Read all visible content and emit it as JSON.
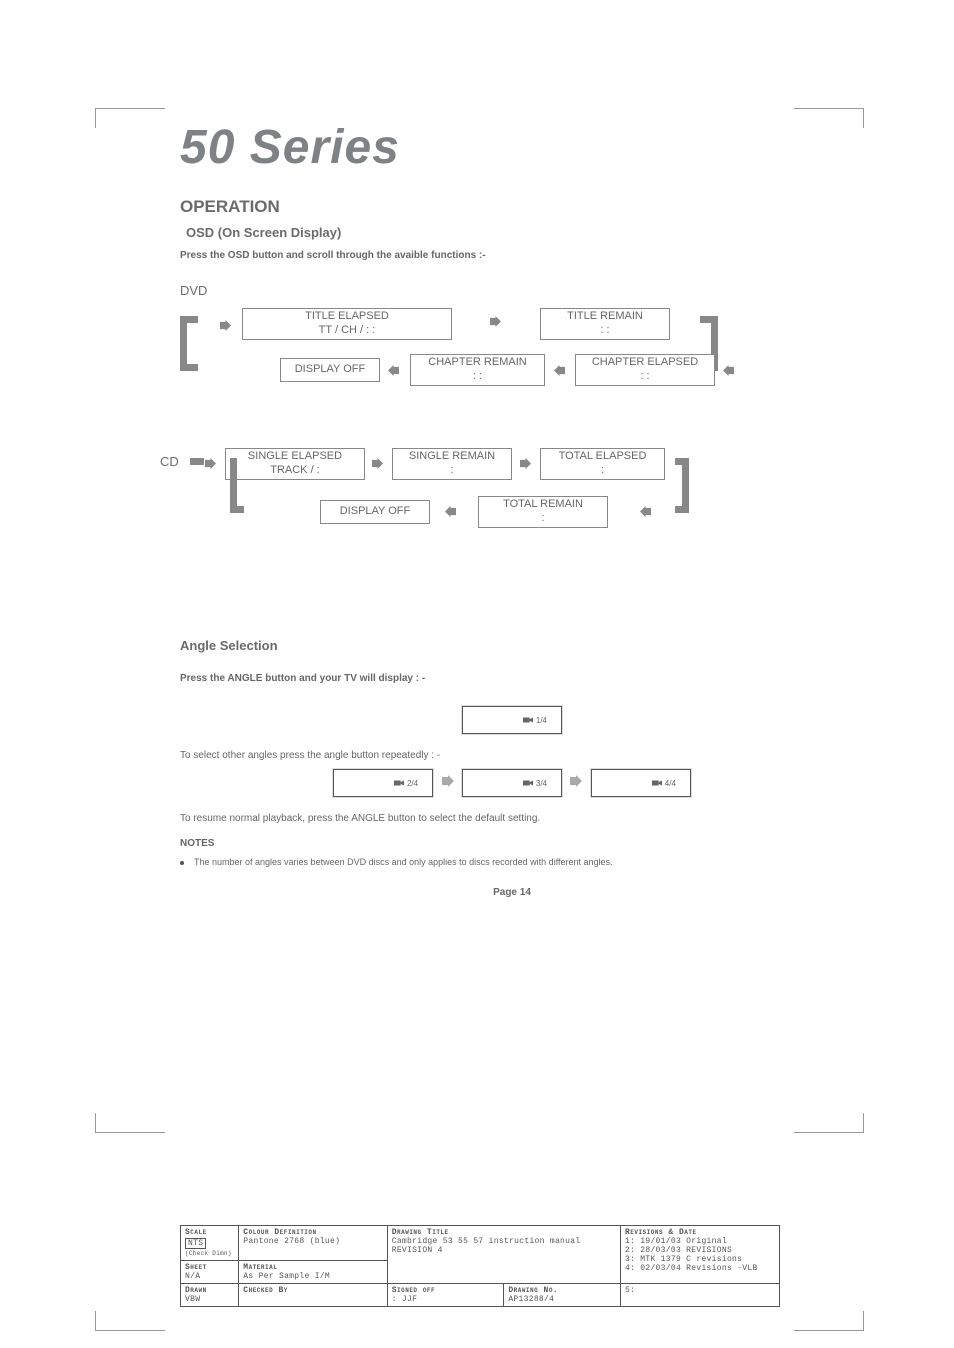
{
  "header": {
    "series_title": "50 Series",
    "operation": "OPERATION",
    "osd_heading": "OSD (On Screen Display)",
    "osd_instruction": "Press the OSD button and scroll through the avaible functions :-"
  },
  "dvd": {
    "label": "DVD",
    "boxes": {
      "title_elapsed_l1": "TITLE ELAPSED",
      "title_elapsed_l2": "TT      /     CH     /         :     :",
      "title_remain_l1": "TITLE REMAIN",
      "title_remain_l2": ":      :",
      "chapter_elapsed_l1": "CHAPTER ELAPSED",
      "chapter_elapsed_l2": ":      :",
      "chapter_remain_l1": "CHAPTER REMAIN",
      "chapter_remain_l2": ":      :",
      "display_off": "DISPLAY OFF"
    }
  },
  "cd": {
    "label": "CD",
    "boxes": {
      "single_elapsed_l1": "SINGLE ELAPSED",
      "single_elapsed_l2": "TRACK      /          :",
      "single_remain_l1": "SINGLE REMAIN",
      "single_remain_l2": ":",
      "total_elapsed_l1": "TOTAL ELAPSED",
      "total_elapsed_l2": ":",
      "total_remain_l1": "TOTAL REMAIN",
      "total_remain_l2": ":",
      "display_off": "DISPLAY OFF"
    }
  },
  "angle": {
    "heading": "Angle Selection",
    "instruction": "Press the ANGLE button and your TV will display : -",
    "boxes": {
      "a1": "1/4",
      "a2": "2/4",
      "a3": "3/4",
      "a4": "4/4"
    },
    "select_other": "To select other angles press the angle button repeatedly : -",
    "resume": "To resume normal playback, press the ANGLE button to select the default setting.",
    "notes_heading": "NOTES",
    "note1": "The number of angles varies between DVD discs and only applies to discs recorded with different angles."
  },
  "page_number": "Page 14",
  "drawing_block": {
    "scale_hd": "Scale",
    "scale_val": "NTS",
    "scale_sub": "(Check Dimn)",
    "colour_hd": "Colour Definition",
    "colour_val": "Pantone  2768 (blue)",
    "sheet_hd": "Sheet",
    "sheet_val": "N/A",
    "material_hd": "Material",
    "material_val": "As Per Sample I/M",
    "drawn_hd": "Drawn",
    "drawn_val": "VBW",
    "checked_hd": "Checked By",
    "signed_hd": "Signed off",
    "signed_val": ": JJF",
    "title_hd": "Drawing Title",
    "title_val": "Cambridge 53 55 57 instruction manual",
    "rev": "REVISION 4",
    "dwgno_hd": "Drawing No.",
    "dwgno_val": "AP13288/4",
    "revisions_hd": "Revisions & Date",
    "rev1": "1: 19/01/03 Original",
    "rev2": "2: 28/03/03 REVISIONS",
    "rev3": "3: MTK 1379 C revisions",
    "rev4": "4: 02/03/04 Revisions -VLB",
    "rev5": "5:"
  }
}
